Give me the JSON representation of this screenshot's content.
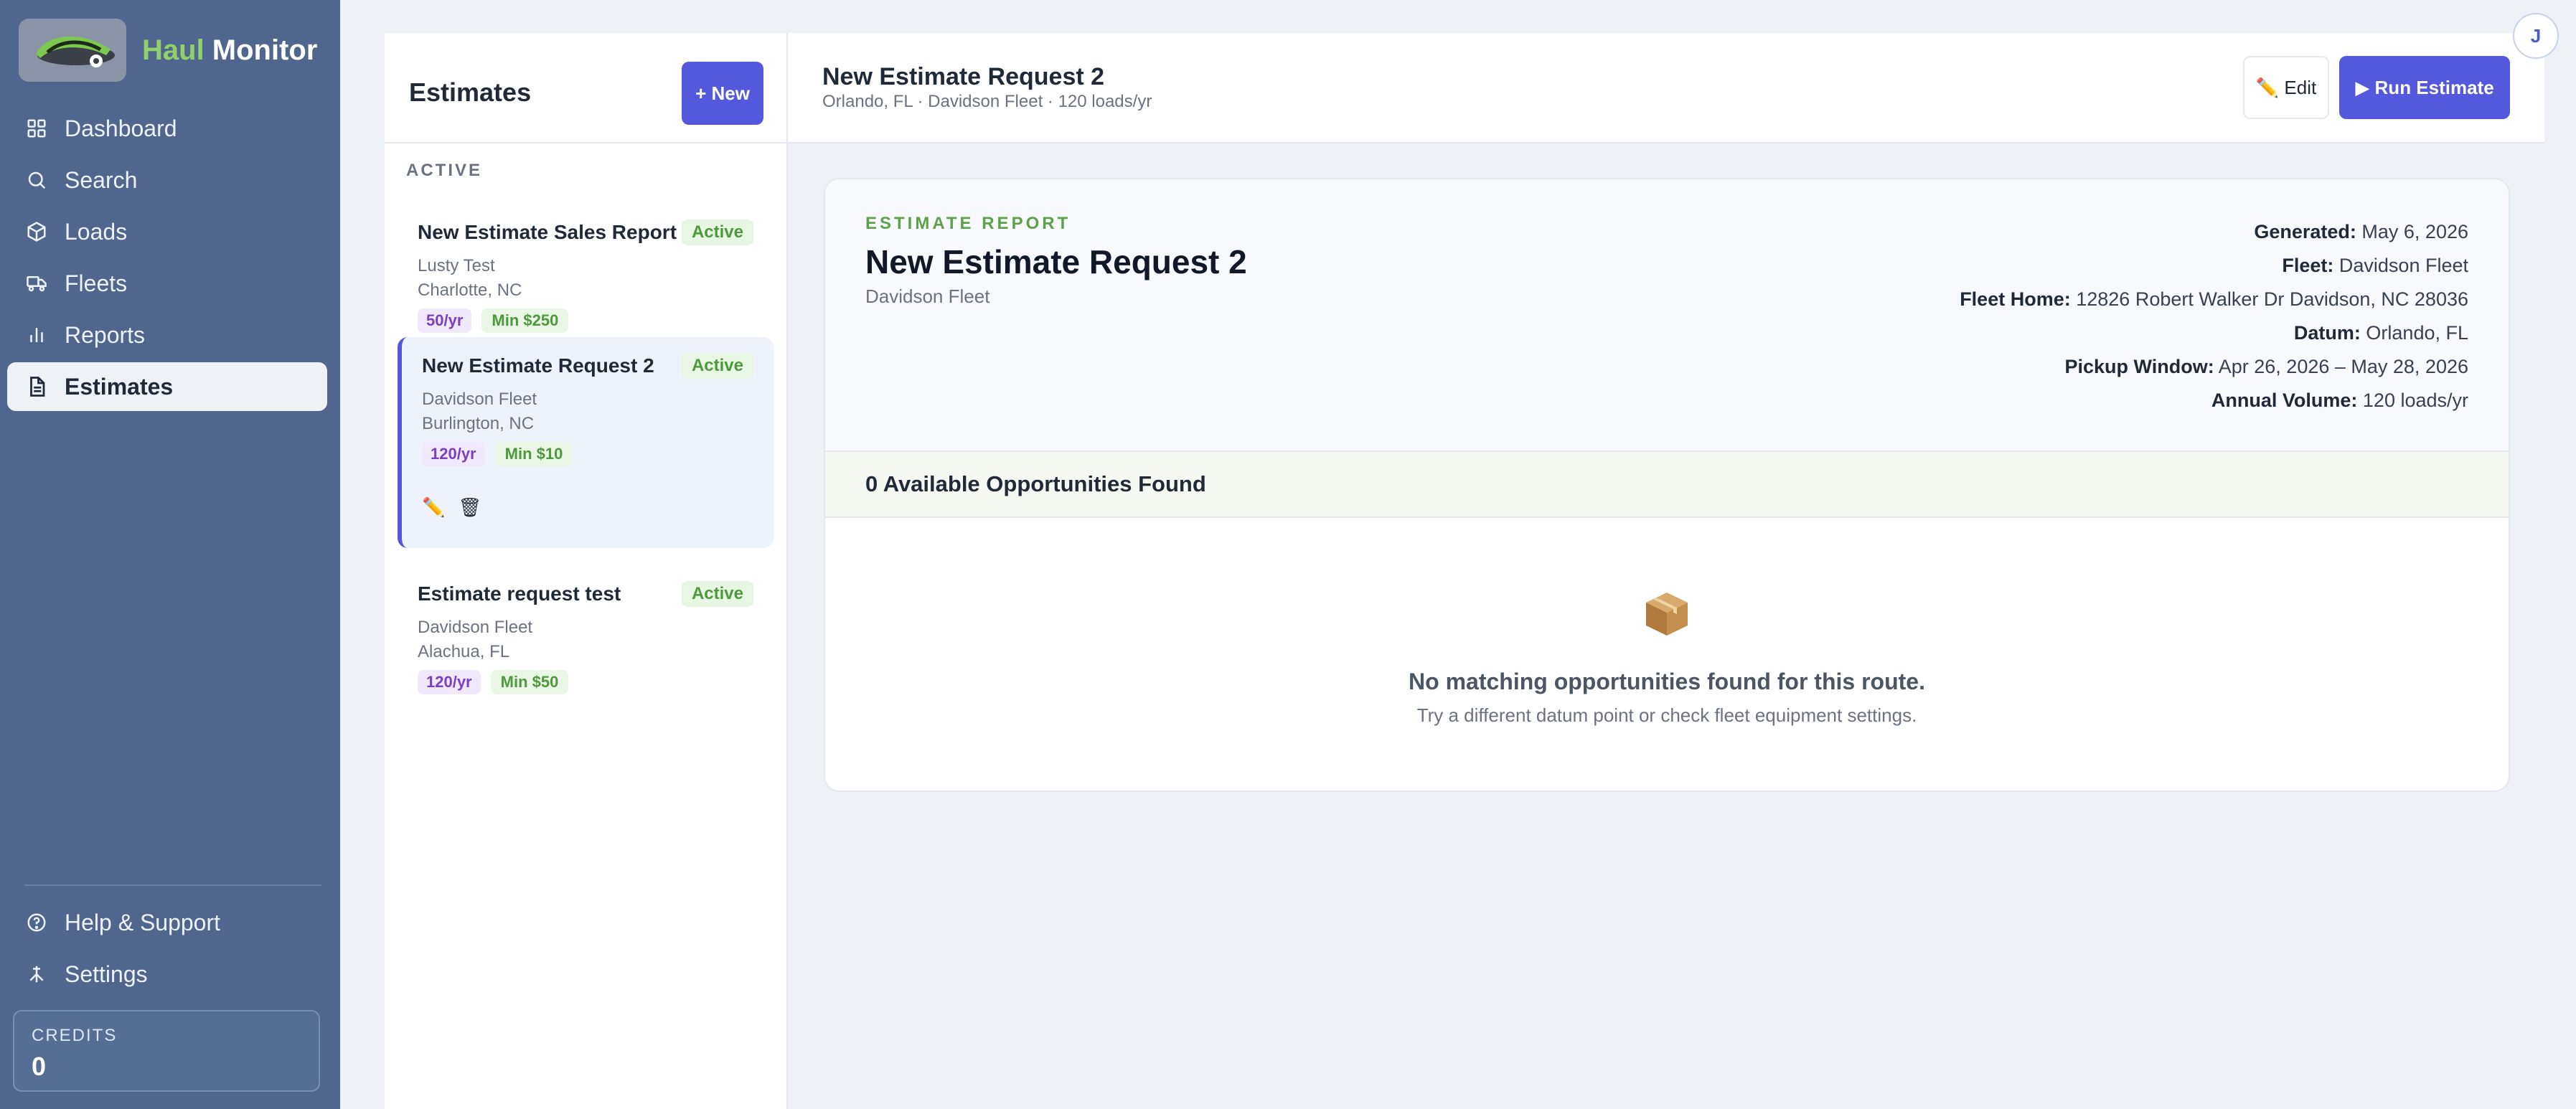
{
  "brand": {
    "name_accent": "Haul",
    "name_rest": " Monitor"
  },
  "nav": {
    "items": [
      {
        "label": "Dashboard",
        "icon": "grid-icon"
      },
      {
        "label": "Search",
        "icon": "search-icon"
      },
      {
        "label": "Loads",
        "icon": "box-icon"
      },
      {
        "label": "Fleets",
        "icon": "truck-icon"
      },
      {
        "label": "Reports",
        "icon": "bar-chart-icon"
      },
      {
        "label": "Estimates",
        "icon": "document-icon",
        "active": true
      }
    ],
    "bottom": [
      {
        "label": "Help & Support",
        "icon": "help-circle-icon"
      },
      {
        "label": "Settings",
        "icon": "settings-icon"
      }
    ]
  },
  "credits": {
    "label": "CREDITS",
    "value": "0"
  },
  "list": {
    "title": "Estimates",
    "new_label": "+ New",
    "section": "ACTIVE",
    "items": [
      {
        "name": "New Estimate Sales Report",
        "status": "Active",
        "fleet": "Lusty Test",
        "location": "Charlotte, NC",
        "volume": "50/yr",
        "min": "Min $250"
      },
      {
        "name": "New Estimate Request 2",
        "status": "Active",
        "fleet": "Davidson Fleet",
        "location": "Burlington, NC",
        "volume": "120/yr",
        "min": "Min $10",
        "edit_icon": "✏️",
        "delete_icon": "🗑"
      },
      {
        "name": "Estimate request test",
        "status": "Active",
        "fleet": "Davidson Fleet",
        "location": "Alachua, FL",
        "volume": "120/yr",
        "min": "Min $50"
      }
    ]
  },
  "header": {
    "title": "New Estimate Request 2",
    "subtitle": "Orlando, FL · Davidson Fleet · 120 loads/yr",
    "edit_label": "✏️ Edit",
    "run_label": "▶ Run Estimate",
    "avatar_initial": "J"
  },
  "report": {
    "kicker": "ESTIMATE REPORT",
    "title": "New Estimate Request 2",
    "fleet": "Davidson Fleet",
    "meta": [
      {
        "key": "Generated:",
        "value": "May 6, 2026"
      },
      {
        "key": "Fleet:",
        "value": "Davidson Fleet"
      },
      {
        "key": "Fleet Home:",
        "value": "12826 Robert Walker Dr Davidson, NC 28036"
      },
      {
        "key": "Datum:",
        "value": "Orlando, FL"
      },
      {
        "key": "Pickup Window:",
        "value": "Apr 26, 2026 – May 28, 2026"
      },
      {
        "key": "Annual Volume:",
        "value": "120 loads/yr"
      }
    ],
    "opportunities": "0 Available Opportunities Found",
    "empty_title": "No matching opportunities found for this route.",
    "empty_sub": "Try a different datum point or check fleet equipment settings."
  },
  "colors": {
    "sidebar": "#50668f",
    "accent": "#5458dc",
    "active_green": "#4c9a3a",
    "brand_green": "#8fd06a"
  }
}
